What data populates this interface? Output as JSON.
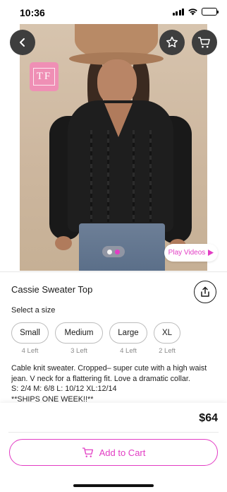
{
  "status_bar": {
    "time": "10:36"
  },
  "logo": {
    "text": "TF"
  },
  "gallery": {
    "play_videos_label": "Play Videos",
    "active_dot_color": "#e23dc4",
    "inactive_dot_color": "#f4f4f4"
  },
  "product": {
    "title": "Cassie Sweater Top",
    "size_prompt": "Select a size",
    "sizes": [
      {
        "label": "Small",
        "stock": "4 Left"
      },
      {
        "label": "Medium",
        "stock": "3 Left"
      },
      {
        "label": "Large",
        "stock": "4 Left"
      },
      {
        "label": "XL",
        "stock": "2 Left"
      }
    ],
    "description": [
      "Cable knit sweater. Cropped– super cute with a high waist",
      "jean. V neck for a flattering fit. Love a dramatic collar.",
      "S: 2/4  M: 6/8  L: 10/12 XL:12/14",
      "**SHIPS ONE WEEK!!**"
    ]
  },
  "footer": {
    "price": "$64",
    "add_to_cart_label": "Add to Cart"
  },
  "colors": {
    "accent": "#e23dc4",
    "logo_bg": "#ef8fb5"
  },
  "icons": {
    "back": "chevron-left-icon",
    "favorite": "star-icon",
    "cart": "cart-icon",
    "share": "share-icon",
    "play": "play-icon"
  }
}
